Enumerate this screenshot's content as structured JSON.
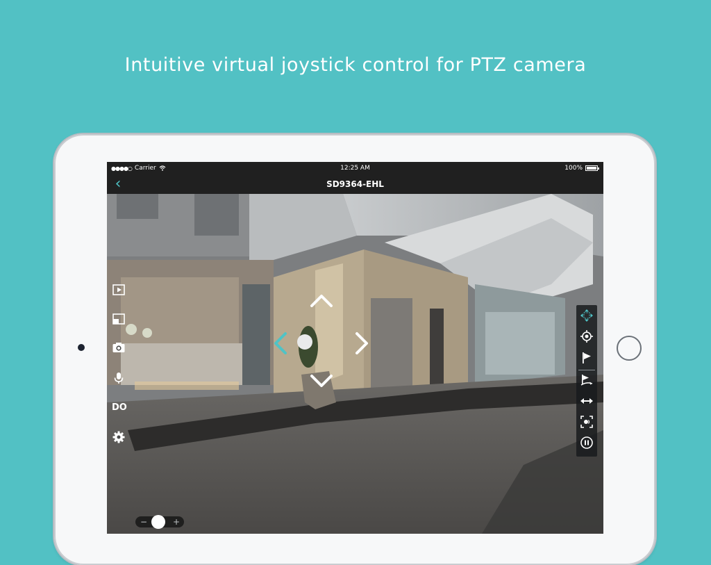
{
  "headline": "Intuitive virtual joystick control for PTZ camera",
  "status_bar": {
    "signal_dots": "●●●●○",
    "carrier": "Carrier",
    "time": "12:25 AM",
    "battery": "100%"
  },
  "nav": {
    "title": "SD9364-EHL",
    "back_glyph": "‹"
  },
  "side_tools": {
    "do_label": "DO",
    "items": [
      "playback-icon",
      "layout-icon",
      "snapshot-icon",
      "microphone-icon",
      "digital-output",
      "settings-icon"
    ]
  },
  "ptz_panel": {
    "items": [
      "ptz-move-icon",
      "focus-target-icon",
      "preset-flag-icon",
      "patrol-flag-icon",
      "auto-pan-icon",
      "auto-focus-icon",
      "pause-icon"
    ]
  },
  "joystick": {
    "directions": [
      "up",
      "down",
      "left",
      "right"
    ],
    "active_direction": "left"
  },
  "zoom_slider": {
    "minus": "−",
    "plus": "+",
    "value": 0.45
  },
  "colors": {
    "background": "#52c1c4",
    "accent": "#4fc3c6",
    "screen_bar": "#202020"
  }
}
